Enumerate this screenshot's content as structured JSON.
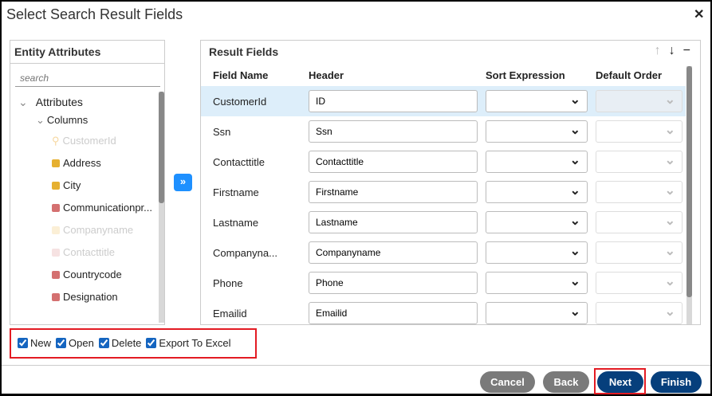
{
  "title": "Select Search Result Fields",
  "entity": {
    "header": "Entity Attributes",
    "search_placeholder": "search",
    "root": "Attributes",
    "group": "Columns",
    "items": [
      {
        "label": "CustomerId",
        "icon": "key-icon",
        "color": "#f6d7a0",
        "faded": true
      },
      {
        "label": "Address",
        "color": "#e6b030"
      },
      {
        "label": "City",
        "color": "#e6b030"
      },
      {
        "label": "Communicationpr...",
        "color": "#d47070"
      },
      {
        "label": "Companyname",
        "color": "#fbefd6",
        "faded": true
      },
      {
        "label": "Contacttitle",
        "color": "#f6e2e2",
        "faded": true
      },
      {
        "label": "Countrycode",
        "color": "#d47070"
      },
      {
        "label": "Designation",
        "color": "#d47070"
      }
    ]
  },
  "result": {
    "header": "Result Fields",
    "columns": [
      "Field Name",
      "Header",
      "Sort Expression",
      "Default Order"
    ],
    "rows": [
      {
        "field": "CustomerId",
        "header": "ID"
      },
      {
        "field": "Ssn",
        "header": "Ssn"
      },
      {
        "field": "Contacttitle",
        "header": "Contacttitle"
      },
      {
        "field": "Firstname",
        "header": "Firstname"
      },
      {
        "field": "Lastname",
        "header": "Lastname"
      },
      {
        "field": "Companyna...",
        "header": "Companyname"
      },
      {
        "field": "Phone",
        "header": "Phone"
      },
      {
        "field": "Emailid",
        "header": "Emailid"
      }
    ]
  },
  "options": [
    {
      "label": "New",
      "checked": true
    },
    {
      "label": "Open",
      "checked": true
    },
    {
      "label": "Delete",
      "checked": true
    },
    {
      "label": "Export To Excel",
      "checked": true
    }
  ],
  "buttons": {
    "cancel": "Cancel",
    "back": "Back",
    "next": "Next",
    "finish": "Finish"
  }
}
